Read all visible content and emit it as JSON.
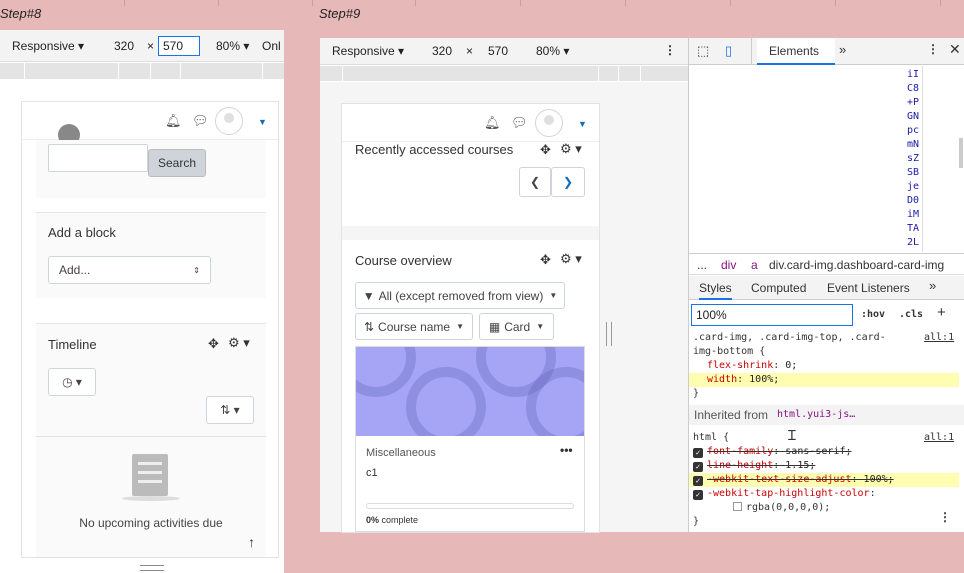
{
  "steps": {
    "left": "Step#8",
    "right": "Step#9"
  },
  "left_device": {
    "mode": "Responsive",
    "width": "320",
    "times": "×",
    "height": "570",
    "zoom": "80%",
    "more": "Onl"
  },
  "left_page": {
    "search_button": "Search",
    "add_block_title": "Add a block",
    "add_block_select": "Add...",
    "timeline_title": "Timeline",
    "no_activities": "No upcoming activities due"
  },
  "right_device": {
    "mode": "Responsive",
    "width": "320",
    "times": "×",
    "height": "570",
    "zoom": "80%"
  },
  "right_page": {
    "recent_title": "Recently accessed courses",
    "overview_title": "Course overview",
    "filter_button": "All (except removed from view)",
    "sort_button": "Course name",
    "view_button": "Card",
    "course_category": "Miscellaneous",
    "course_name": "c1",
    "progress_pct": "0%",
    "progress_text": " complete",
    "progress_value": 0
  },
  "devtools": {
    "tab_elements": "Elements",
    "dom_lines": [
      "iI",
      "C8",
      "+P",
      "GN",
      "pc",
      "mN",
      "sZ",
      "SB",
      "je",
      "D0",
      "iM",
      "TA",
      "2L"
    ],
    "crumbs": [
      "...",
      "div",
      "a",
      "div.card-img.dashboard-card-img"
    ],
    "subtabs": [
      "Styles",
      "Computed",
      "Event Listeners"
    ],
    "filter_value": "100%",
    "hov": ":hov",
    "cls": ".cls",
    "rule1_selector": ".card-img, .card-img-top, .card-img-bottom {",
    "rule1_source": "all:1",
    "rule1_props": [
      {
        "name": "flex-shrink",
        "value": "0;"
      },
      {
        "name": "width",
        "value": "100%;"
      }
    ],
    "close_brace": "}",
    "inherited_label": "Inherited from ",
    "inherited_from": "html.yui3-js…",
    "rule2_selector": "html {",
    "rule2_source": "all:1",
    "rule2_props": [
      {
        "name": "font-family",
        "value": "sans-serif;"
      },
      {
        "name": "line-height",
        "value": "1.15;"
      },
      {
        "name": "-webkit-text-size-adjust",
        "value": "100%;"
      },
      {
        "name": "-webkit-tap-highlight-color",
        "value": ""
      }
    ],
    "rgba_value": "rgba(0,0,0,0);"
  },
  "colors": {
    "accent": "#0f6cbf",
    "course_image": "#a5a4f5",
    "highlight": "#fefdb0",
    "devtools_blue": "#1a73e8"
  }
}
